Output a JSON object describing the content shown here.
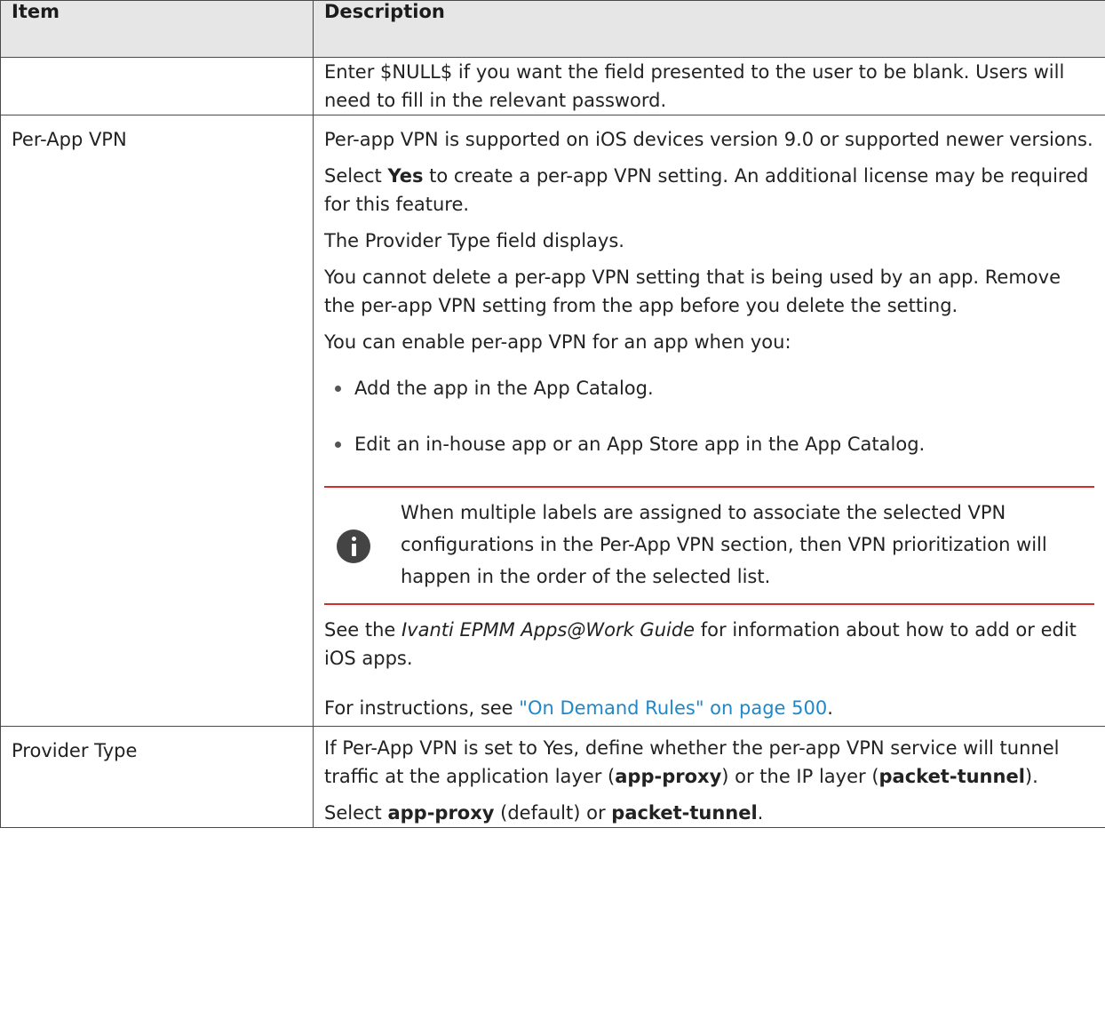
{
  "header": {
    "item": "Item",
    "description": "Description"
  },
  "row1": {
    "item": "",
    "text": "Enter $NULL$ if you want the field presented to the user to be blank. Users will need to fill in the relevant password."
  },
  "row2": {
    "item": "Per-App VPN",
    "p1": "Per-app VPN is supported on iOS devices version 9.0 or supported newer versions.",
    "p2_pre": "Select ",
    "p2_bold": "Yes",
    "p2_post": " to create a per-app VPN setting. An additional license may be required for this feature.",
    "p3": "The Provider Type field displays.",
    "p4": "You cannot delete a per-app VPN setting that is being used by an app. Remove the per-app VPN setting from the app before you delete the setting.",
    "p5": "You can enable per-app VPN for an app when you:",
    "bullets": [
      "Add the app in the App Catalog.",
      "Edit an in-house app or an App Store app in the App Catalog."
    ],
    "note": "When multiple labels are assigned to associate the selected VPN configurations in the Per-App VPN section, then VPN prioritization will happen in the order of the selected list.",
    "note_icon": "info-icon",
    "p6_pre": "See the ",
    "p6_italic": "Ivanti EPMM Apps@Work Guide",
    "p6_post": " for information about how to add or edit iOS apps.",
    "p7_pre": "For instructions, see ",
    "p7_link": "\"On Demand Rules\" on page 500",
    "p7_post": "."
  },
  "row3": {
    "item": "Provider Type",
    "p1_pre": "If Per-App VPN is set to Yes, define whether the per-app VPN service will tunnel traffic at the application layer (",
    "p1_bold1": "app-proxy",
    "p1_mid": ") or the IP layer (",
    "p1_bold2": "packet-tunnel",
    "p1_post": ").",
    "p2_pre": "Select ",
    "p2_bold1": "app-proxy",
    "p2_mid": " (default) or ",
    "p2_bold2": "packet-tunnel",
    "p2_post": "."
  },
  "colors": {
    "link": "#1e88c8",
    "note_rule": "#d32f2f",
    "header_bg": "#e6e6e6"
  }
}
